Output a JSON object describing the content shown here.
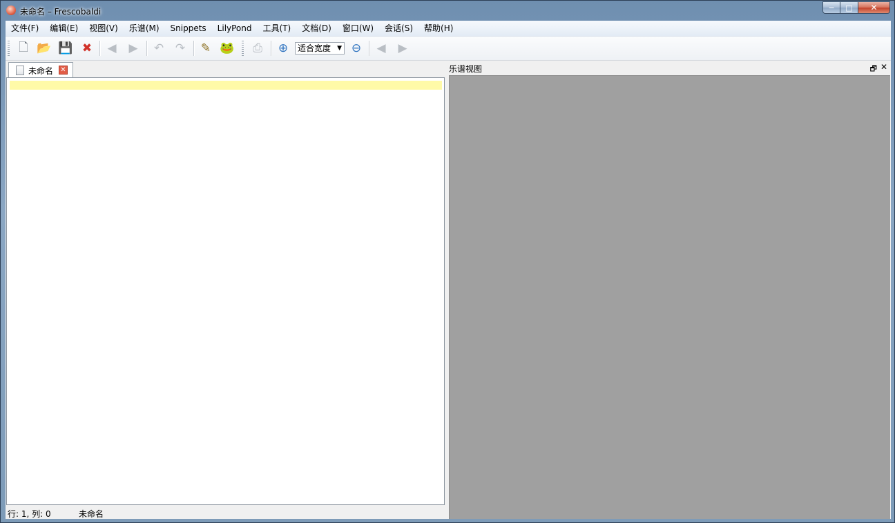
{
  "window": {
    "title": "未命名 – Frescobaldi",
    "min": "─",
    "max": "□",
    "close": "✕"
  },
  "menu": [
    "文件(F)",
    "编辑(E)",
    "视图(V)",
    "乐谱(M)",
    "Snippets",
    "LilyPond",
    "工具(T)",
    "文档(D)",
    "窗口(W)",
    "会话(S)",
    "帮助(H)"
  ],
  "toolbar": {
    "icons": {
      "new": "🗋",
      "open": "📂",
      "save": "💾",
      "close": "✖",
      "back": "◀",
      "forward": "▶",
      "undo": "↶",
      "redo": "↷",
      "edit": "✎",
      "lilypond": "🐸",
      "print": "⎙",
      "zoom_in": "⊕",
      "zoom_out": "⊖",
      "prev_page": "◀",
      "next_page": "▶"
    },
    "zoom_value": "适合宽度",
    "zoom_arrow": "▼"
  },
  "editor": {
    "tab_label": "未命名",
    "tab_close": "✕"
  },
  "status": {
    "position": "行: 1, 列: 0",
    "document": "未命名"
  },
  "score_panel": {
    "title": "乐谱视图",
    "float": "🗗",
    "close": "✕"
  },
  "colors": {
    "current_line": "#fffaa8",
    "score_background": "#a0a0a0",
    "tab_close": "#e25d47"
  }
}
